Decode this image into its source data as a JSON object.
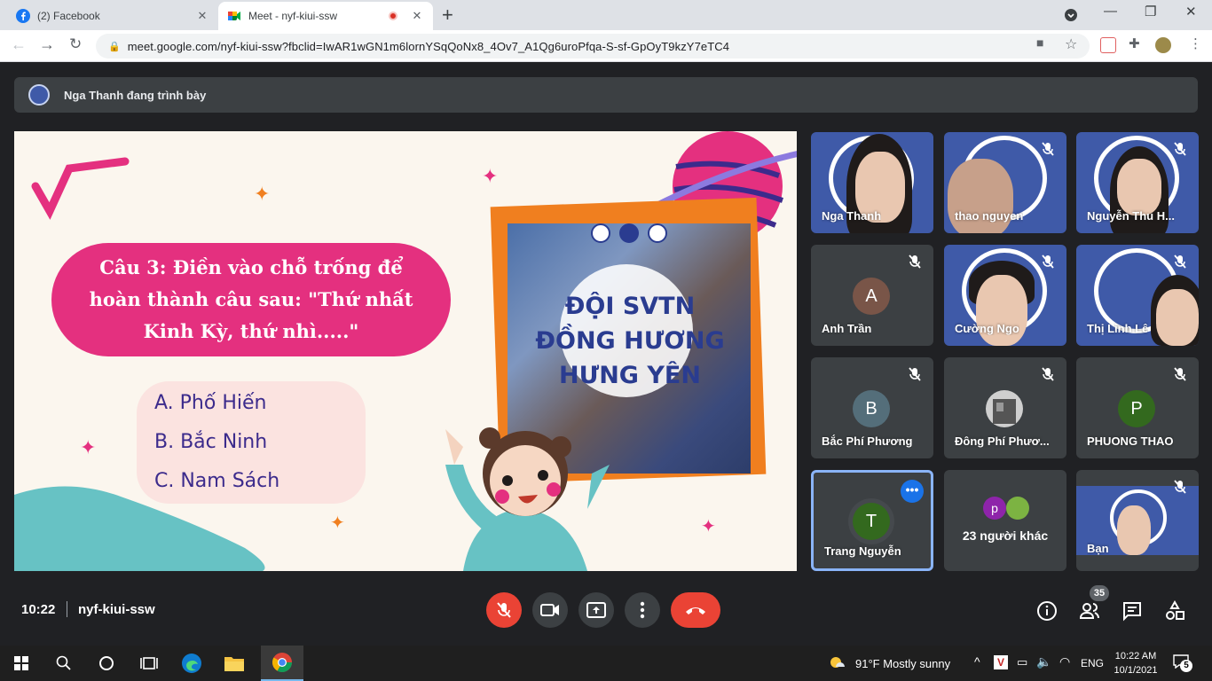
{
  "browser": {
    "tabs": [
      {
        "title": "(2) Facebook",
        "active": false
      },
      {
        "title": "Meet - nyf-kiui-ssw",
        "active": true
      }
    ],
    "url": "meet.google.com/nyf-kiui-ssw?fbclid=IwAR1wGN1m6lornYSqQoNx8_4Ov7_A1Qg6uroPfqa-S-sf-GpOyT9kzY7eTC4",
    "window_controls": {
      "minimize": "—",
      "maximize": "❐",
      "close": "✕"
    }
  },
  "presentation": {
    "banner": "Nga Thanh đang trình bày"
  },
  "slide": {
    "question": "Câu 3: Điền vào chỗ trống để hoàn thành câu sau: \"Thứ nhất Kinh Kỳ, thứ nhì.....\"",
    "answers": [
      "A. Phố Hiến",
      "B. Bắc Ninh",
      "C. Nam Sách"
    ],
    "team_title_lines": [
      "ĐỘI SVTN",
      "ĐỒNG HƯƠNG",
      "HƯNG YÊN"
    ]
  },
  "participants": [
    {
      "name": "Nga Thanh",
      "kind": "video",
      "muted": false
    },
    {
      "name": "thao nguyen",
      "kind": "video",
      "muted": true
    },
    {
      "name": "Nguyễn Thu H...",
      "kind": "video",
      "muted": true
    },
    {
      "name": "Anh Trần",
      "kind": "initial",
      "initial": "A",
      "color": "#795548",
      "muted": true
    },
    {
      "name": "Cường Ngo",
      "kind": "video",
      "muted": true
    },
    {
      "name": "Thị Linh Lê",
      "kind": "video",
      "muted": true
    },
    {
      "name": "Bắc Phí Phương",
      "kind": "initial",
      "initial": "B",
      "color": "#546e7a",
      "muted": true
    },
    {
      "name": "Đông Phí Phươ...",
      "kind": "photo",
      "muted": true
    },
    {
      "name": "PHUONG THAO",
      "kind": "initial",
      "initial": "P",
      "color": "#33691e",
      "muted": true
    },
    {
      "name": "Trang Nguyễn",
      "kind": "initial",
      "initial": "T",
      "color": "#33691e",
      "muted": false,
      "selected": true
    },
    {
      "name": "23 người khác",
      "kind": "others",
      "initial": "p"
    },
    {
      "name": "Bạn",
      "kind": "video",
      "muted": true
    }
  ],
  "meeting": {
    "time": "10:22",
    "code": "nyf-kiui-ssw",
    "people_count": "35"
  },
  "taskbar": {
    "weather": "91°F  Mostly sunny",
    "language": "ENG",
    "time": "10:22 AM",
    "date": "10/1/2021",
    "notifications": "5"
  },
  "colors": {
    "meet_bg": "#202124",
    "accent_blue": "#1a73e8",
    "danger_red": "#ea4335",
    "slide_pink": "#e4307f",
    "slide_orange": "#f07f1f"
  }
}
